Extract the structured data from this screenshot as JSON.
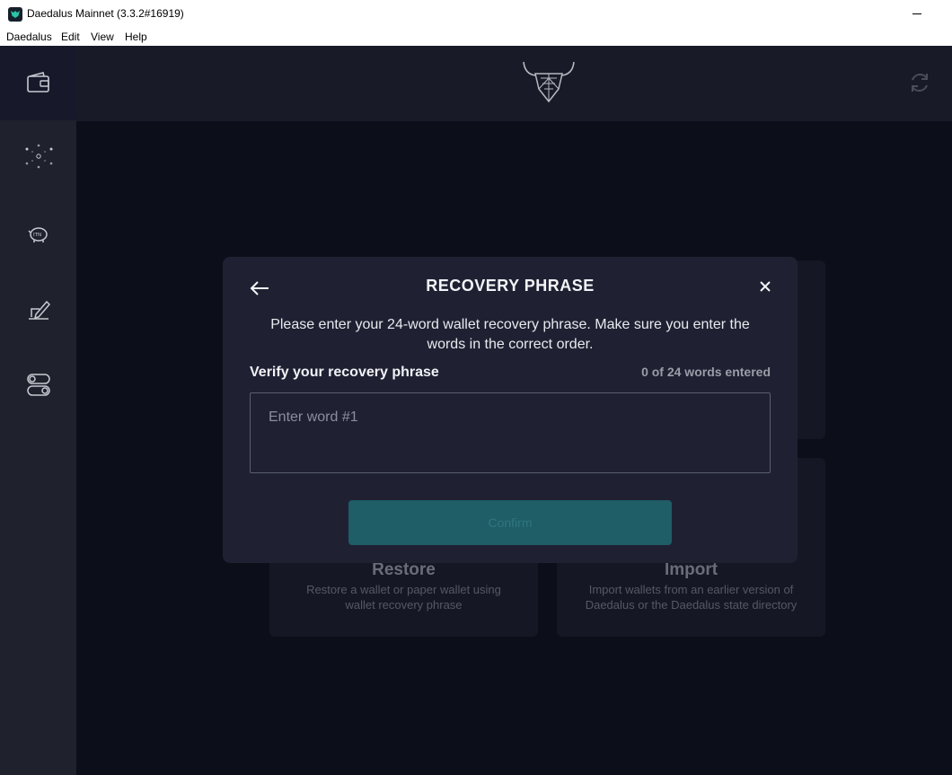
{
  "window": {
    "title": "Daedalus Mainnet (3.3.2#16919)"
  },
  "menu": [
    "Daedalus",
    "Edit",
    "View",
    "Help"
  ],
  "sidebar": {
    "items": [
      {
        "icon": "wallet-icon",
        "active": true
      },
      {
        "icon": "network-dots-icon",
        "active": false
      },
      {
        "icon": "itn-piggy-bank-icon",
        "active": false
      },
      {
        "icon": "voting-sign-icon",
        "active": false
      },
      {
        "icon": "settings-toggle-icon",
        "active": false
      }
    ]
  },
  "topbar": {
    "logo": "daedalus-logo-icon",
    "sync": "sync-icon"
  },
  "background_cards": [
    {
      "title": "Restore",
      "description": [
        "Restore a wallet or paper wallet using",
        "wallet recovery phrase"
      ]
    },
    {
      "title": "Import",
      "description": [
        "Import wallets from an earlier version of",
        "Daedalus or the Daedalus state directory"
      ]
    }
  ],
  "modal": {
    "title": "RECOVERY PHRASE",
    "description": "Please enter your 24-word wallet recovery phrase. Make sure you enter the words in the correct order.",
    "field_label": "Verify your recovery phrase",
    "word_count": "0 of 24 words entered",
    "input_placeholder": "Enter word #1",
    "input_value": "",
    "confirm_label": "Confirm"
  },
  "colors": {
    "app_background": "#0c0e1a",
    "sidebar": "#1f212d",
    "modal": "#1f2133",
    "confirm_disabled": "#1f5d67",
    "accent": "#2bc4a6"
  }
}
